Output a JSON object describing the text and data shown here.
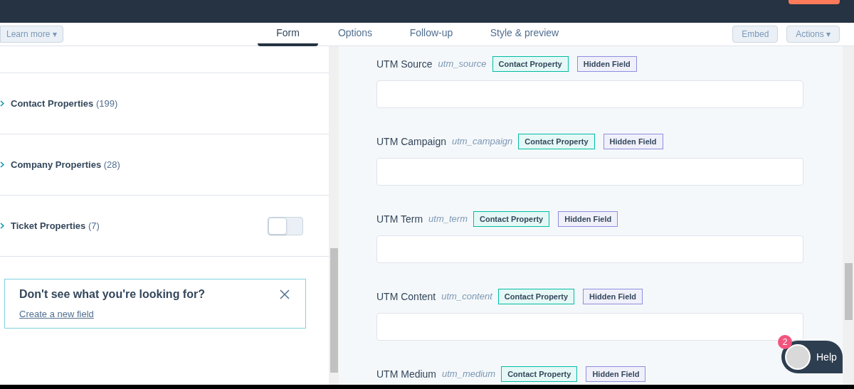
{
  "header": {
    "learn_more": "Learn more ▾",
    "tabs": [
      {
        "label": "Form",
        "selected": true
      },
      {
        "label": "Options",
        "selected": false
      },
      {
        "label": "Follow-up",
        "selected": false
      },
      {
        "label": "Style & preview",
        "selected": false
      }
    ],
    "embed": "Embed",
    "actions": "Actions ▾"
  },
  "sidebar": {
    "categories": [
      {
        "kind": "plain",
        "name": "Contact Properties",
        "count": "(199)"
      },
      {
        "kind": "plain",
        "name": "Company Properties",
        "count": "(28)"
      },
      {
        "kind": "toggle",
        "name": "Ticket Properties",
        "count": "(7)",
        "on": false
      }
    ],
    "notice": {
      "title": "Don't see what you're looking for?",
      "link": "Create a new field"
    }
  },
  "fields": [
    {
      "label": "UTM Source",
      "internal": "utm_source",
      "tags": [
        "Contact Property",
        "Hidden Field"
      ]
    },
    {
      "label": "UTM Campaign",
      "internal": "utm_campaign",
      "tags": [
        "Contact Property",
        "Hidden Field"
      ]
    },
    {
      "label": "UTM Term",
      "internal": "utm_term",
      "tags": [
        "Contact Property",
        "Hidden Field"
      ]
    },
    {
      "label": "UTM Content",
      "internal": "utm_content",
      "tags": [
        "Contact Property",
        "Hidden Field"
      ]
    },
    {
      "label": "UTM Medium",
      "internal": "utm_medium",
      "tags": [
        "Contact Property",
        "Hidden Field"
      ]
    }
  ],
  "help": {
    "badge": "2",
    "label": "Help"
  }
}
